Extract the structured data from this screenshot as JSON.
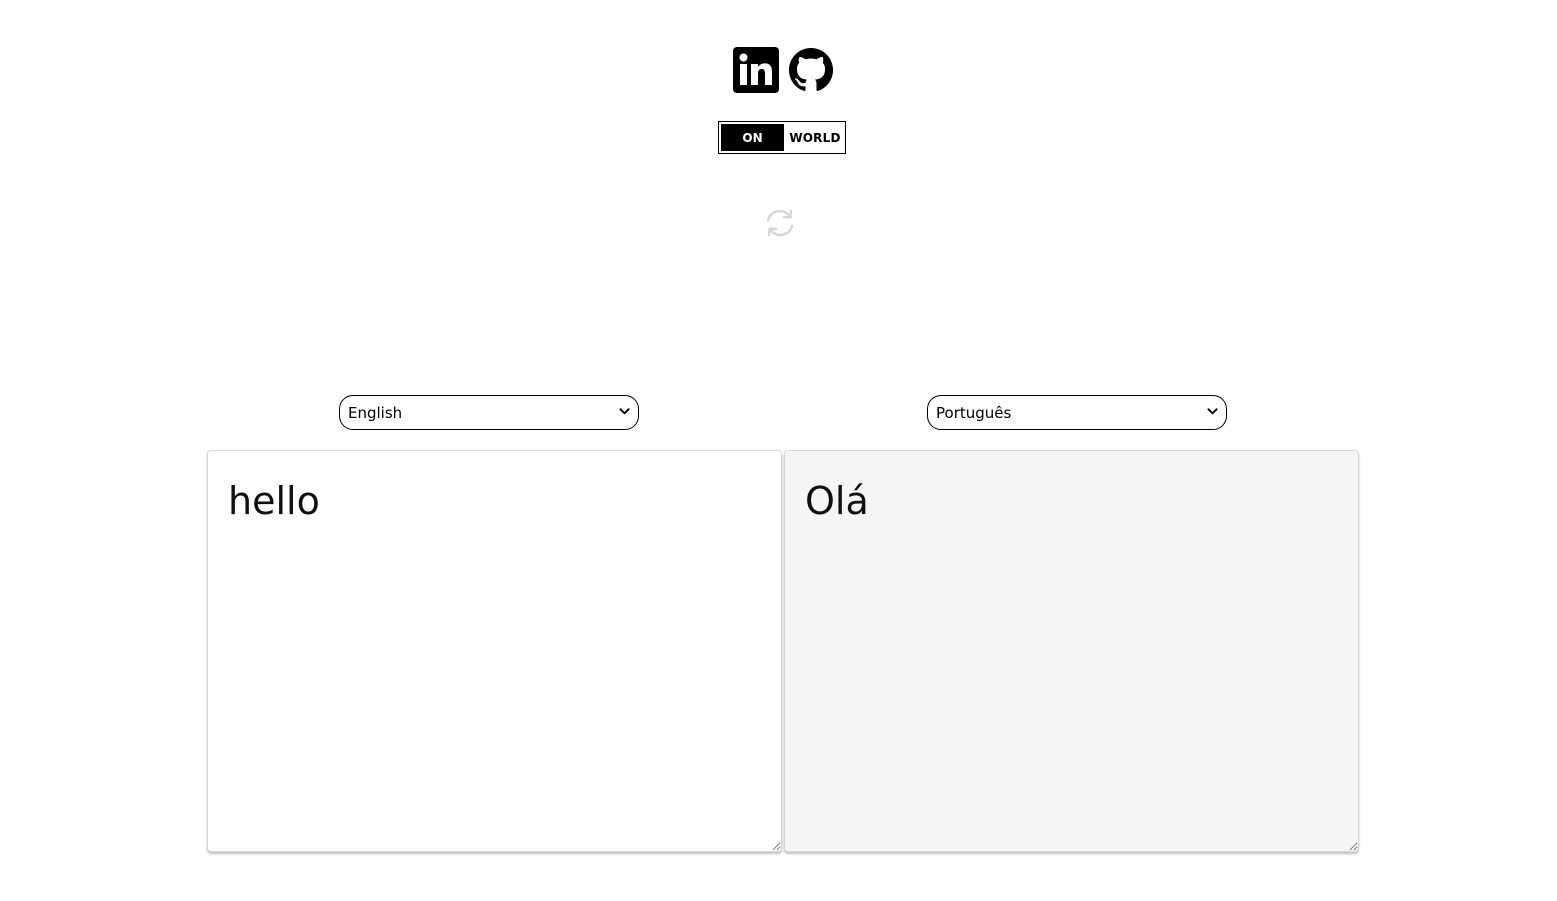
{
  "social": {
    "linkedin_icon": "linkedin-icon",
    "github_icon": "github-icon"
  },
  "toggle": {
    "on_label": "ON",
    "world_label": "WORLD"
  },
  "swap": {
    "icon": "swap-arrows-icon",
    "color": "#d9d9d9"
  },
  "source": {
    "language": "English",
    "text": "hello"
  },
  "target": {
    "language": "Português",
    "text": "Olá"
  },
  "colors": {
    "target_bg": "#f5f5f5",
    "accent": "#000000"
  }
}
